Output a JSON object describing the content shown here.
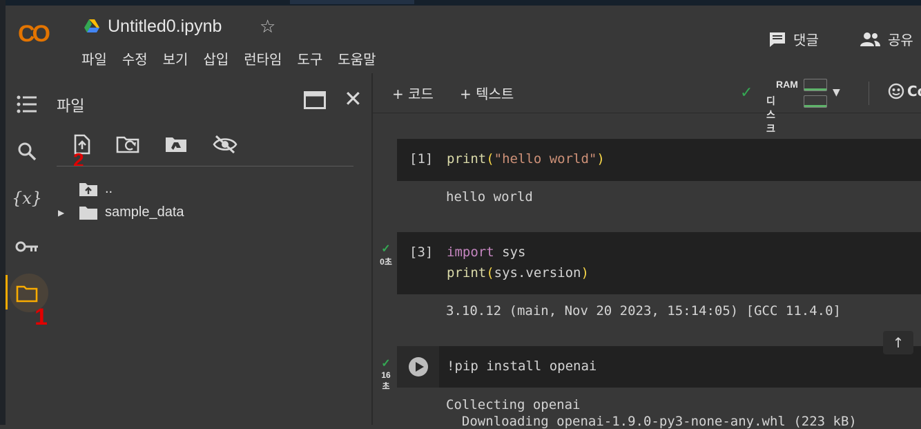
{
  "app": {
    "title": "Untitled0.ipynb",
    "logo_text": "CO",
    "menu": [
      "파일",
      "수정",
      "보기",
      "삽입",
      "런타임",
      "도구",
      "도움말"
    ],
    "comment_label": "댓글",
    "share_label": "공유",
    "accent_color": "#f9ab00"
  },
  "panel": {
    "title": "파일",
    "tree": [
      {
        "name": "..",
        "icon": "folder-up-icon"
      },
      {
        "name": "sample_data",
        "icon": "folder-icon",
        "expandable": true
      }
    ]
  },
  "annotations": {
    "one": "1",
    "two": "2"
  },
  "toolbar": {
    "add_code": "+ 코드",
    "add_text": "+ 텍스트",
    "ram_label": "RAM",
    "disk_label": "디스크",
    "connect_partial": "Co"
  },
  "cells": [
    {
      "number": "[1]",
      "code": "print(\"hello world\")",
      "output": "hello world"
    },
    {
      "number": "[3]",
      "exec_time": "0초",
      "code_line1": "import sys",
      "code_line2": "print(sys.version)",
      "output": "3.10.12 (main, Nov 20 2023, 15:14:05) [GCC 11.4.0]"
    },
    {
      "exec_time_line1": "16",
      "exec_time_line2": "초",
      "code": "!pip install openai",
      "output_line1": "Collecting openai",
      "output_line2": "  Downloading openai-1.9.0-py3-none-any.whl (223 kB)"
    }
  ]
}
